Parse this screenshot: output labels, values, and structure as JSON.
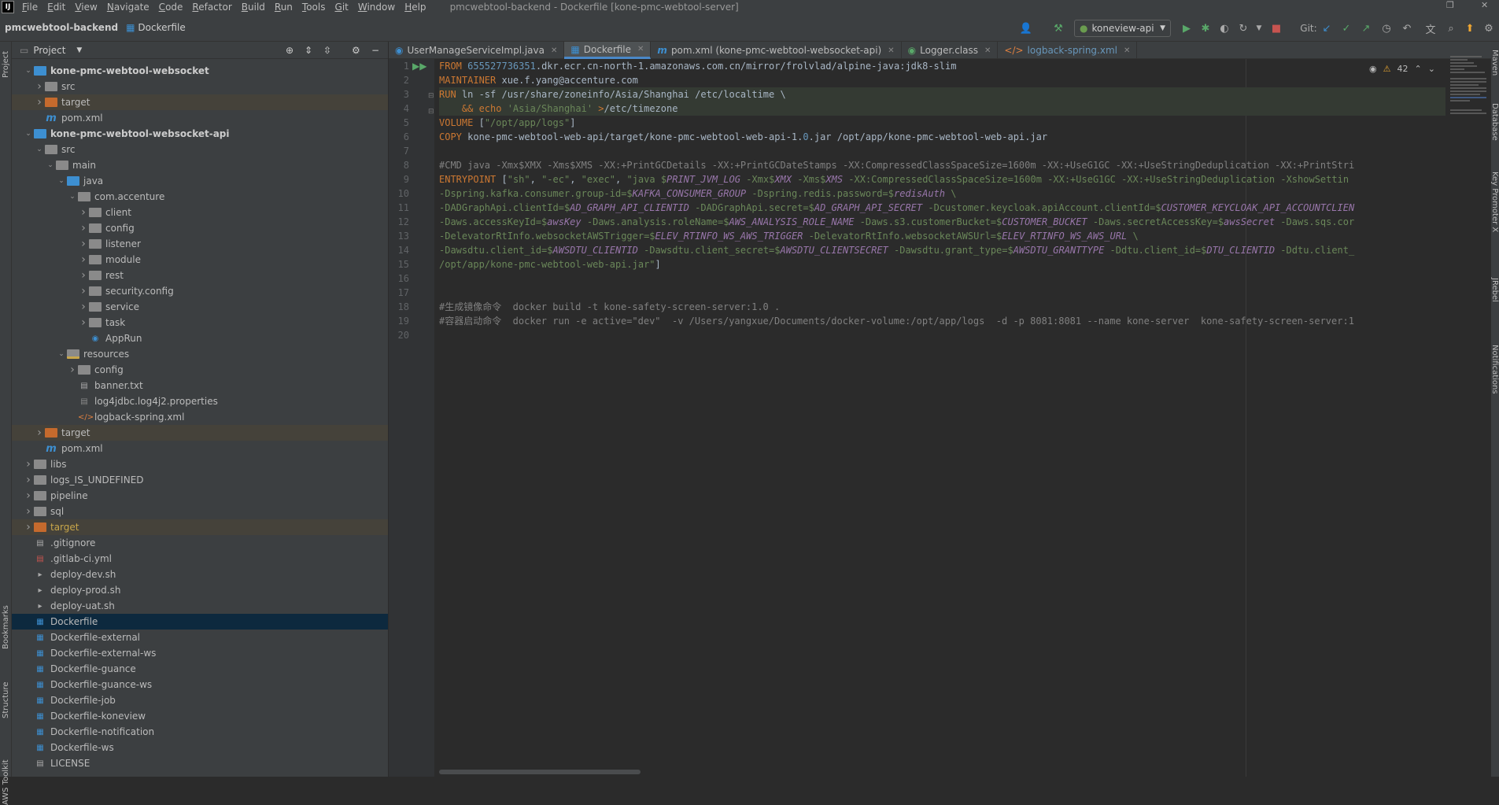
{
  "menubar": {
    "logo": "IJ",
    "items": [
      "File",
      "Edit",
      "View",
      "Navigate",
      "Code",
      "Refactor",
      "Build",
      "Run",
      "Tools",
      "Git",
      "Window",
      "Help"
    ],
    "window_title": "pmcwebtool-backend - Dockerfile [kone-pmc-webtool-server]"
  },
  "navbar": {
    "project": "pmcwebtool-backend",
    "file": "Dockerfile",
    "run_config": "koneview-api",
    "git_label": "Git:"
  },
  "side": {
    "project": "Project",
    "bookmarks": "Bookmarks",
    "structure": "Structure",
    "aws": "AWS Toolkit",
    "maven": "Maven",
    "database": "Database",
    "key_promoter": "Key Promoter X",
    "jrebel": "JRebel",
    "notifications": "Notifications"
  },
  "project_panel": {
    "title": "Project"
  },
  "tree": [
    {
      "label": "kone-pmc-webtool-websocket",
      "depth": 1,
      "arrow": "down",
      "icon": "folder-module",
      "bold": true
    },
    {
      "label": "src",
      "depth": 2,
      "arrow": "right",
      "icon": "folder-grey"
    },
    {
      "label": "target",
      "depth": 2,
      "arrow": "right",
      "icon": "folder-orange",
      "excluded": true
    },
    {
      "label": "pom.xml",
      "depth": 2,
      "arrow": "",
      "icon": "maven"
    },
    {
      "label": "kone-pmc-webtool-websocket-api",
      "depth": 1,
      "arrow": "down",
      "icon": "folder-module",
      "bold": true
    },
    {
      "label": "src",
      "depth": 2,
      "arrow": "down",
      "icon": "folder-grey"
    },
    {
      "label": "main",
      "depth": 3,
      "arrow": "down",
      "icon": "folder-grey"
    },
    {
      "label": "java",
      "depth": 4,
      "arrow": "down",
      "icon": "folder-blue"
    },
    {
      "label": "com.accenture",
      "depth": 5,
      "arrow": "down",
      "icon": "package"
    },
    {
      "label": "client",
      "depth": 6,
      "arrow": "right",
      "icon": "package"
    },
    {
      "label": "config",
      "depth": 6,
      "arrow": "right",
      "icon": "package"
    },
    {
      "label": "listener",
      "depth": 6,
      "arrow": "right",
      "icon": "package"
    },
    {
      "label": "module",
      "depth": 6,
      "arrow": "right",
      "icon": "package"
    },
    {
      "label": "rest",
      "depth": 6,
      "arrow": "right",
      "icon": "package"
    },
    {
      "label": "security.config",
      "depth": 6,
      "arrow": "right",
      "icon": "package"
    },
    {
      "label": "service",
      "depth": 6,
      "arrow": "right",
      "icon": "package"
    },
    {
      "label": "task",
      "depth": 6,
      "arrow": "right",
      "icon": "package"
    },
    {
      "label": "AppRun",
      "depth": 6,
      "arrow": "",
      "icon": "class"
    },
    {
      "label": "resources",
      "depth": 4,
      "arrow": "down",
      "icon": "folder-res"
    },
    {
      "label": "config",
      "depth": 5,
      "arrow": "right",
      "icon": "folder-grey"
    },
    {
      "label": "banner.txt",
      "depth": 5,
      "arrow": "",
      "icon": "text"
    },
    {
      "label": "log4jdbc.log4j2.properties",
      "depth": 5,
      "arrow": "",
      "icon": "props"
    },
    {
      "label": "logback-spring.xml",
      "depth": 5,
      "arrow": "",
      "icon": "xml"
    },
    {
      "label": "target",
      "depth": 2,
      "arrow": "right",
      "icon": "folder-orange",
      "excluded": true
    },
    {
      "label": "pom.xml",
      "depth": 2,
      "arrow": "",
      "icon": "maven"
    },
    {
      "label": "libs",
      "depth": 1,
      "arrow": "right",
      "icon": "folder-grey"
    },
    {
      "label": "logs_IS_UNDEFINED",
      "depth": 1,
      "arrow": "right",
      "icon": "folder-grey"
    },
    {
      "label": "pipeline",
      "depth": 1,
      "arrow": "right",
      "icon": "folder-grey"
    },
    {
      "label": "sql",
      "depth": 1,
      "arrow": "right",
      "icon": "folder-grey"
    },
    {
      "label": "target",
      "depth": 1,
      "arrow": "right",
      "icon": "folder-orange",
      "excluded": true,
      "orange_text": true
    },
    {
      "label": ".gitignore",
      "depth": 1,
      "arrow": "",
      "icon": "text"
    },
    {
      "label": ".gitlab-ci.yml",
      "depth": 1,
      "arrow": "",
      "icon": "yml"
    },
    {
      "label": "deploy-dev.sh",
      "depth": 1,
      "arrow": "",
      "icon": "shell"
    },
    {
      "label": "deploy-prod.sh",
      "depth": 1,
      "arrow": "",
      "icon": "shell"
    },
    {
      "label": "deploy-uat.sh",
      "depth": 1,
      "arrow": "",
      "icon": "shell"
    },
    {
      "label": "Dockerfile",
      "depth": 1,
      "arrow": "",
      "icon": "docker",
      "selected": true
    },
    {
      "label": "Dockerfile-external",
      "depth": 1,
      "arrow": "",
      "icon": "docker"
    },
    {
      "label": "Dockerfile-external-ws",
      "depth": 1,
      "arrow": "",
      "icon": "docker"
    },
    {
      "label": "Dockerfile-guance",
      "depth": 1,
      "arrow": "",
      "icon": "docker"
    },
    {
      "label": "Dockerfile-guance-ws",
      "depth": 1,
      "arrow": "",
      "icon": "docker"
    },
    {
      "label": "Dockerfile-job",
      "depth": 1,
      "arrow": "",
      "icon": "docker"
    },
    {
      "label": "Dockerfile-koneview",
      "depth": 1,
      "arrow": "",
      "icon": "docker"
    },
    {
      "label": "Dockerfile-notification",
      "depth": 1,
      "arrow": "",
      "icon": "docker"
    },
    {
      "label": "Dockerfile-ws",
      "depth": 1,
      "arrow": "",
      "icon": "docker"
    },
    {
      "label": "LICENSE",
      "depth": 1,
      "arrow": "",
      "icon": "text"
    }
  ],
  "tabs": [
    {
      "label": "UserManageServiceImpl.java",
      "icon": "class",
      "active": false
    },
    {
      "label": "Dockerfile",
      "icon": "docker",
      "active": true
    },
    {
      "label": "pom.xml (kone-pmc-webtool-websocket-api)",
      "icon": "maven",
      "active": false
    },
    {
      "label": "Logger.class",
      "icon": "class-lib",
      "active": false
    },
    {
      "label": "logback-spring.xml",
      "icon": "xml",
      "active": false
    }
  ],
  "editor": {
    "warnings": "42",
    "line_numbers": [
      "1",
      "2",
      "3",
      "4",
      "5",
      "6",
      "7",
      "8",
      "9",
      "10",
      "11",
      "12",
      "13",
      "14",
      "15",
      "16",
      "17",
      "18",
      "19",
      "20"
    ]
  },
  "code_lines": [
    [
      [
        "kw",
        "FROM "
      ],
      [
        "num",
        "655527736351"
      ],
      [
        "",
        "."
      ],
      [
        "",
        "dkr.ecr.cn-north-1.amazonaws.com.cn/mirror/frolvlad/alpine-java:jdk8-slim"
      ]
    ],
    [
      [
        "kw",
        "MAINTAINER "
      ],
      [
        "",
        "xue.f.yang@accenture.com"
      ]
    ],
    [
      [
        "kw",
        "RUN "
      ],
      [
        "",
        "ln -sf /usr/share/zoneinfo/Asia/Shanghai /etc/localtime \\"
      ]
    ],
    [
      [
        "",
        "    "
      ],
      [
        "kw",
        "&& echo "
      ],
      [
        "str",
        "'Asia/Shanghai' "
      ],
      [
        "kw",
        "&gt;"
      ],
      [
        "",
        "/etc/timezone"
      ]
    ],
    [
      [
        "kw",
        "VOLUME "
      ],
      [
        "",
        "["
      ],
      [
        "str",
        "\"/opt/app/logs\""
      ],
      [
        "",
        "]"
      ]
    ],
    [
      [
        "kw",
        "COPY "
      ],
      [
        "",
        "kone-pmc-webtool-web-api/target/kone-pmc-webtool-web-api-1."
      ],
      [
        "num",
        "0"
      ],
      [
        "",
        ".jar /opt/app/kone-pmc-webtool-web-api.jar"
      ]
    ],
    [],
    [
      [
        "cmt",
        "#CMD java -Xmx$XMX -Xms$XMS -XX:+PrintGCDetails -XX:+PrintGCDateStamps -XX:CompressedClassSpaceSize=1600m -XX:+UseG1GC -XX:+UseStringDeduplication -XX:+PrintStri"
      ]
    ],
    [
      [
        "kw",
        "ENTRYPOINT "
      ],
      [
        "",
        "["
      ],
      [
        "str",
        "\"sh\""
      ],
      [
        "",
        ", "
      ],
      [
        "str",
        "\"-ec\""
      ],
      [
        "",
        ", "
      ],
      [
        "str",
        "\"exec\""
      ],
      [
        "",
        ", "
      ],
      [
        "str",
        "\"java $"
      ],
      [
        "var",
        "PRINT_JVM_LOG"
      ],
      [
        "str",
        " -Xmx$"
      ],
      [
        "var",
        "XMX"
      ],
      [
        "str",
        " -Xms$"
      ],
      [
        "var",
        "XMS"
      ],
      [
        "str",
        " -XX:CompressedClassSpaceSize=1600m -XX:+UseG1GC -XX:+UseStringDeduplication -XshowSettin"
      ]
    ],
    [
      [
        "str",
        "-Dspring.kafka.consumer.group-id=$"
      ],
      [
        "var",
        "KAFKA_CONSUMER_GROUP"
      ],
      [
        "str",
        " -Dspring.redis.password=$"
      ],
      [
        "var",
        "redisAuth"
      ],
      [
        "str",
        " \\"
      ]
    ],
    [
      [
        "str",
        "-DADGraphApi.clientId=$"
      ],
      [
        "var",
        "AD_GRAPH_API_CLIENTID"
      ],
      [
        "str",
        " -DADGraphApi.secret=$"
      ],
      [
        "var",
        "AD_GRAPH_API_SECRET"
      ],
      [
        "str",
        " -Dcustomer.keycloak.apiAccount.clientId=$"
      ],
      [
        "var",
        "CUSTOMER_KEYCLOAK_API_ACCOUNTCLIEN"
      ]
    ],
    [
      [
        "str",
        "-Daws.accessKeyId=$"
      ],
      [
        "var",
        "awsKey"
      ],
      [
        "str",
        " -Daws.analysis.roleName=$"
      ],
      [
        "var",
        "AWS_ANALYSIS_ROLE_NAME"
      ],
      [
        "str",
        " -Daws.s3.customerBucket=$"
      ],
      [
        "var",
        "CUSTOMER_BUCKET"
      ],
      [
        "str",
        " -Daws.secretAccessKey=$"
      ],
      [
        "var",
        "awsSecret"
      ],
      [
        "str",
        " -Daws.sqs.cor"
      ]
    ],
    [
      [
        "str",
        "-DelevatorRtInfo.websocketAWSTrigger=$"
      ],
      [
        "var",
        "ELEV_RTINFO_WS_AWS_TRIGGER"
      ],
      [
        "str",
        " -DelevatorRtInfo.websocketAWSUrl=$"
      ],
      [
        "var",
        "ELEV_RTINFO_WS_AWS_URL"
      ],
      [
        "str",
        " \\"
      ]
    ],
    [
      [
        "str",
        "-Dawsdtu.client_id=$"
      ],
      [
        "var",
        "AWSDTU_CLIENTID"
      ],
      [
        "str",
        " -Dawsdtu.client_secret=$"
      ],
      [
        "var",
        "AWSDTU_CLIENTSECRET"
      ],
      [
        "str",
        " -Dawsdtu.grant_type=$"
      ],
      [
        "var",
        "AWSDTU_GRANTTYPE"
      ],
      [
        "str",
        " -Ddtu.client_id=$"
      ],
      [
        "var",
        "DTU_CLIENTID"
      ],
      [
        "str",
        " -Ddtu.client_"
      ]
    ],
    [
      [
        "str",
        "/opt/app/kone-pmc-webtool-web-api.jar\""
      ],
      [
        "",
        "]"
      ]
    ],
    [],
    [],
    [
      [
        "cmt",
        "#生成镜像命令  docker build -t kone-safety-screen-server:1.0 ."
      ]
    ],
    [
      [
        "cmt",
        "#容器启动命令  docker run -e active=\"dev\"  -v /Users/yangxue/Documents/docker-volume:/opt/app/logs  -d -p 8081:8081 --name kone-server  kone-safety-screen-server:1"
      ]
    ],
    []
  ],
  "colors": {
    "keyword": "#cc7832",
    "string": "#6a8759",
    "number": "#6897bb",
    "variable": "#9876aa",
    "comment": "#808080",
    "text": "#a9b7c6",
    "selection": "#0d293e"
  }
}
